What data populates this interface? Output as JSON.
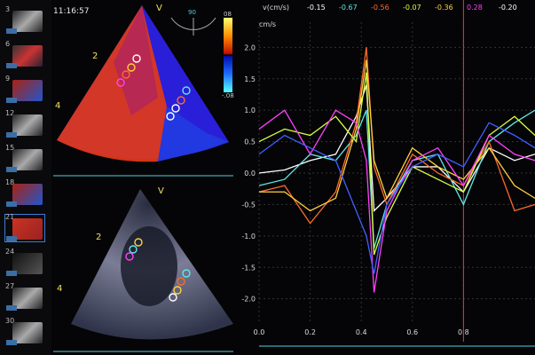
{
  "timestamp": "11:16:57",
  "thumbnails": [
    {
      "n": "3",
      "tone": "gray"
    },
    {
      "n": "6",
      "tone": "mixed"
    },
    {
      "n": "9",
      "tone": "redblue"
    },
    {
      "n": "12",
      "tone": "gray"
    },
    {
      "n": "15",
      "tone": "gray"
    },
    {
      "n": "18",
      "tone": "redblue"
    },
    {
      "n": "21",
      "tone": "red",
      "selected": true
    },
    {
      "n": "24",
      "tone": "dark"
    },
    {
      "n": "27",
      "tone": "gray"
    },
    {
      "n": "30",
      "tone": "gray"
    }
  ],
  "tdi_panel": {
    "marker_v": "V",
    "label_2": "2",
    "label_4": "4",
    "angle_readout": "90",
    "scale_top": "08",
    "scale_bottom": "-.08"
  },
  "bmode_panel": {
    "marker_v": "V",
    "label_2": "2",
    "label_4": "4"
  },
  "velocity_header": {
    "label": "v(cm/s)",
    "values": [
      {
        "text": "-0.15",
        "color": "#ffffff"
      },
      {
        "text": "-0.67",
        "color": "#5fe8e8"
      },
      {
        "text": "-0.56",
        "color": "#ff6a2a"
      },
      {
        "text": "-0.07",
        "color": "#d8ff40"
      },
      {
        "text": "-0.36",
        "color": "#ffd040"
      },
      {
        "text": "0.28",
        "color": "#ff40ff"
      },
      {
        "text": "-0.20",
        "color": "#ffffff"
      }
    ]
  },
  "chart_data": {
    "type": "line",
    "ylabel": "cm/s",
    "xticks": [
      "0.0",
      "0.2",
      "0.4",
      "0.6",
      "0.8"
    ],
    "yticks": [
      "2.0",
      "1.5",
      "1.0",
      "0.5",
      "0.0",
      "-0.5",
      "-1.0",
      "-1.5",
      "-2.0"
    ],
    "xlim": [
      0,
      1.08
    ],
    "ylim": [
      -2.4,
      2.4
    ],
    "cursor_x": 0.8,
    "series": [
      {
        "color": "#ffffff",
        "x": [
          0,
          0.1,
          0.2,
          0.3,
          0.38,
          0.42,
          0.45,
          0.5,
          0.6,
          0.7,
          0.8,
          0.9,
          1.0,
          1.08
        ],
        "y": [
          0.0,
          0.05,
          0.2,
          0.3,
          0.9,
          1.4,
          -0.6,
          -0.4,
          0.1,
          0.1,
          -0.3,
          0.4,
          0.2,
          0.3
        ]
      },
      {
        "color": "#5fe8e8",
        "x": [
          0,
          0.1,
          0.2,
          0.3,
          0.38,
          0.42,
          0.45,
          0.5,
          0.6,
          0.7,
          0.8,
          0.9,
          1.0,
          1.08
        ],
        "y": [
          -0.2,
          -0.1,
          0.3,
          0.2,
          0.6,
          1.0,
          -1.2,
          -0.5,
          0.2,
          0.3,
          -0.5,
          0.5,
          0.8,
          1.0
        ]
      },
      {
        "color": "#ff6a2a",
        "x": [
          0,
          0.1,
          0.2,
          0.3,
          0.38,
          0.42,
          0.45,
          0.5,
          0.6,
          0.7,
          0.8,
          0.9,
          1.0,
          1.08
        ],
        "y": [
          -0.3,
          -0.2,
          -0.8,
          -0.3,
          0.8,
          2.0,
          0.1,
          -0.5,
          0.3,
          0.0,
          -0.2,
          0.5,
          -0.6,
          -0.5
        ]
      },
      {
        "color": "#d8ff40",
        "x": [
          0,
          0.1,
          0.2,
          0.3,
          0.38,
          0.42,
          0.45,
          0.5,
          0.6,
          0.7,
          0.8,
          0.9,
          1.0,
          1.08
        ],
        "y": [
          0.5,
          0.7,
          0.6,
          0.9,
          0.5,
          1.6,
          -1.3,
          -0.7,
          0.1,
          -0.1,
          -0.3,
          0.6,
          0.9,
          0.6
        ]
      },
      {
        "color": "#ffd040",
        "x": [
          0,
          0.1,
          0.2,
          0.3,
          0.38,
          0.42,
          0.45,
          0.5,
          0.6,
          0.7,
          0.8,
          0.9,
          1.0,
          1.08
        ],
        "y": [
          -0.3,
          -0.3,
          -0.6,
          -0.4,
          0.7,
          1.8,
          0.2,
          -0.4,
          0.4,
          0.1,
          -0.1,
          0.4,
          -0.2,
          -0.4
        ]
      },
      {
        "color": "#ff40ff",
        "x": [
          0,
          0.1,
          0.2,
          0.3,
          0.38,
          0.42,
          0.45,
          0.5,
          0.6,
          0.7,
          0.8,
          0.9,
          1.0,
          1.08
        ],
        "y": [
          0.7,
          1.0,
          0.3,
          1.0,
          0.8,
          0.2,
          -1.9,
          -0.6,
          0.2,
          0.4,
          -0.2,
          0.6,
          0.3,
          0.2
        ]
      },
      {
        "color": "#4060ff",
        "x": [
          0,
          0.1,
          0.2,
          0.3,
          0.38,
          0.42,
          0.45,
          0.5,
          0.6,
          0.7,
          0.8,
          0.9,
          1.0,
          1.08
        ],
        "y": [
          0.3,
          0.6,
          0.4,
          0.2,
          -0.6,
          -1.0,
          -1.6,
          -0.5,
          0.1,
          0.3,
          0.1,
          0.8,
          0.6,
          0.4
        ]
      }
    ]
  }
}
